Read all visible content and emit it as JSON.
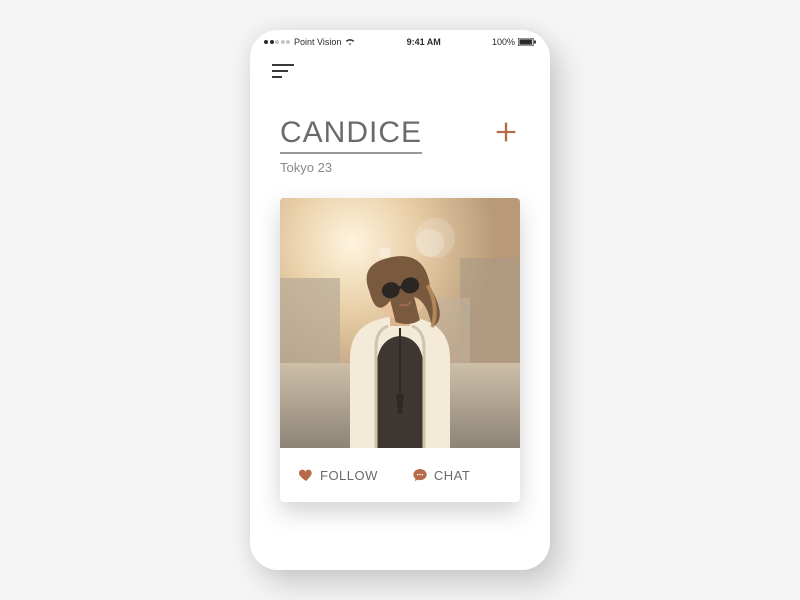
{
  "accent": "#b66a4a",
  "status": {
    "carrier": "Point Vision",
    "time": "9:41 AM",
    "battery": "100%"
  },
  "profile": {
    "name": "CANDICE",
    "location": "Tokyo",
    "age": "23"
  },
  "actions": {
    "follow": "FOLLOW",
    "chat": "CHAT"
  }
}
